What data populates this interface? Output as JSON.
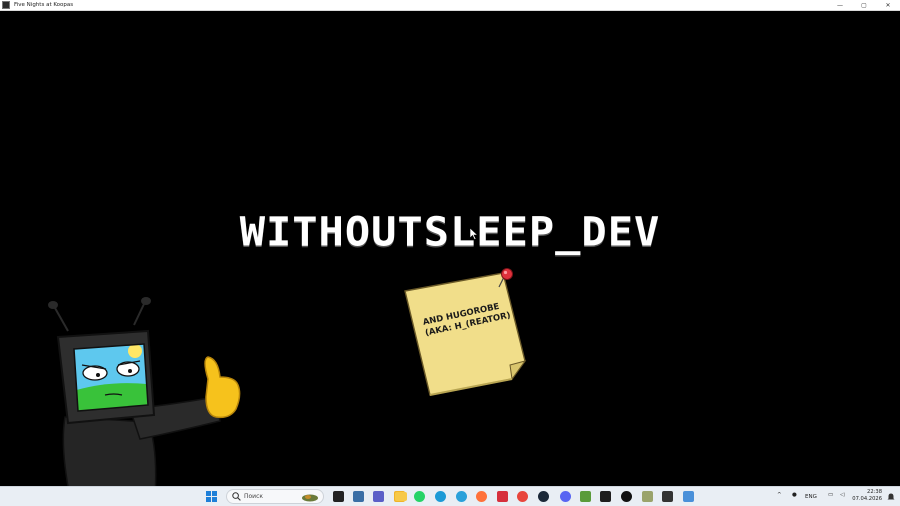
{
  "window": {
    "title": "Five Nights at Koopas",
    "controls": {
      "minimize": "—",
      "maximize": "▢",
      "close": "✕"
    }
  },
  "game": {
    "credit_title": "WITHOUTSLEEP_DEV",
    "sticky_note": {
      "line1": "AND HUGOROBE",
      "line2": "(AKA: H_(REATOR)"
    },
    "colors": {
      "background": "#000000",
      "note": "#f1de8a",
      "pin": "#e0323c",
      "tv_body": "#2a2a2a",
      "screen_sky": "#5ec8ee",
      "screen_grass": "#39c23a",
      "thumb": "#f6c21c"
    }
  },
  "taskbar": {
    "search_placeholder": "Поиск",
    "apps": [
      "file-explorer-icon",
      "task-view-icon",
      "widgets-icon",
      "teams-icon",
      "folder-icon",
      "whatsapp-icon",
      "edge-icon",
      "telegram-icon",
      "firefox-icon",
      "app-icon",
      "chrome-icon",
      "steam-icon",
      "discord-icon",
      "minecraft-icon",
      "terminal-icon",
      "v2-icon",
      "game-icon",
      "paint-icon",
      "snipping-icon"
    ],
    "tray": {
      "language": "ENG",
      "time": "22:38",
      "date": "07.04.2026"
    }
  }
}
